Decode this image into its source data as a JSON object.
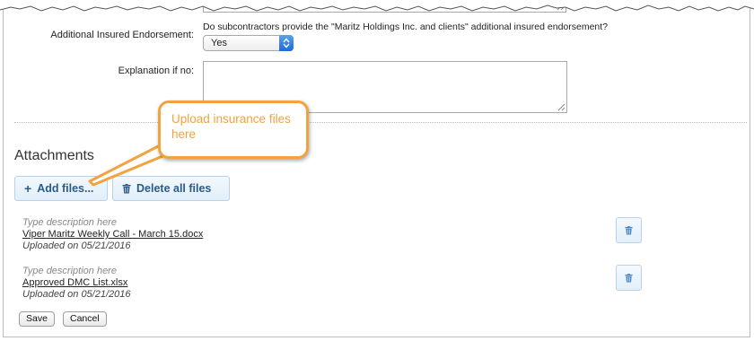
{
  "form": {
    "additional_insured_label": "Additional Insured Endorsement:",
    "additional_insured_question": "Do subcontractors provide the \"Maritz Holdings Inc. and clients\" additional insured endorsement?",
    "additional_insured_value": "Yes",
    "explanation_label": "Explanation if no:",
    "explanation_value": ""
  },
  "attachments": {
    "title": "Attachments",
    "add_files_label": "Add files...",
    "delete_all_label": "Delete all files",
    "files": [
      {
        "description": "Type description here",
        "name": "Viper Maritz Weekly Call - March 15.docx",
        "uploaded": "Uploaded on 05/21/2016"
      },
      {
        "description": "Type description here",
        "name": "Approved DMC List.xlsx",
        "uploaded": "Uploaded on 05/21/2016"
      }
    ]
  },
  "actions": {
    "save_label": "Save",
    "cancel_label": "Cancel"
  },
  "callout": {
    "text": "Upload insurance files here"
  },
  "colors": {
    "accent_orange": "#f0a340",
    "button_text_blue": "#2a5c8a",
    "select_arrow_blue": "#1f6ad9"
  },
  "icons": {
    "add": "plus-icon",
    "delete_all": "trash-icon",
    "file_delete": "trash-icon",
    "select": "chevron-updown-icon"
  }
}
